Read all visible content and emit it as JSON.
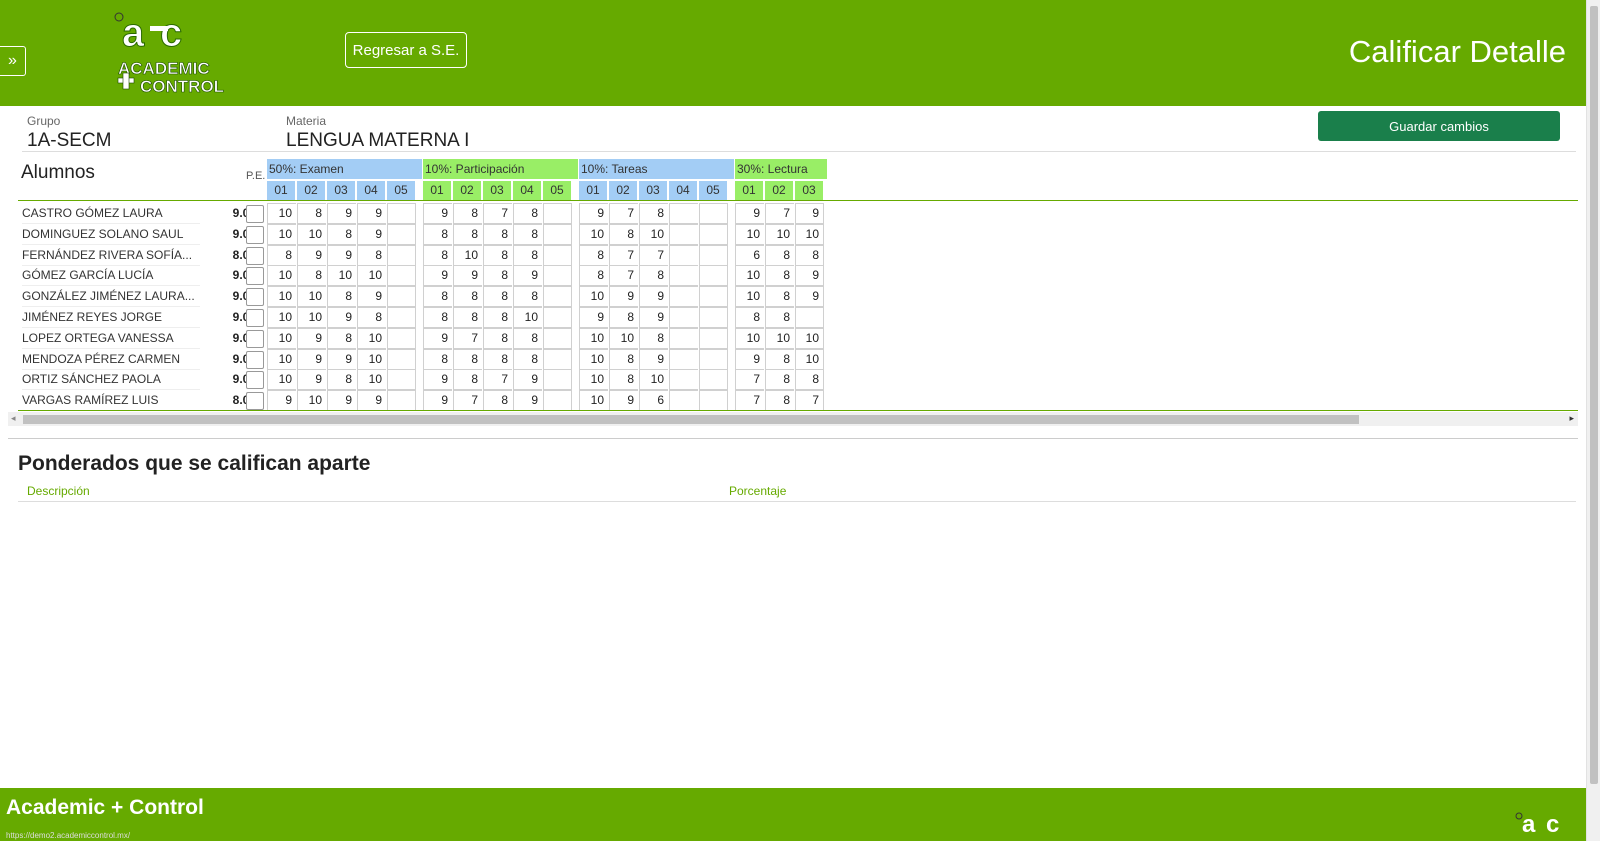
{
  "header": {
    "back_label": "Regresar a S.E.",
    "page_title": "Calificar Detalle",
    "logo_top": "ACADEMIC",
    "logo_bottom": "CONTROL",
    "colors": {
      "header": "#66aa00",
      "save_button": "#1a7f4b"
    }
  },
  "info": {
    "group_label": "Grupo",
    "group_value": "1A-SECM",
    "subject_label": "Materia",
    "subject_value": "LENGUA MATERNA I",
    "save_label": "Guardar cambios"
  },
  "grid": {
    "title": "Alumnos",
    "pe_label": "P.E.",
    "groups": [
      {
        "label": "50%: Examen",
        "cols": [
          "01",
          "02",
          "03",
          "04",
          "05"
        ],
        "color": "blue"
      },
      {
        "label": "10%: Participación",
        "cols": [
          "01",
          "02",
          "03",
          "04",
          "05"
        ],
        "color": "green"
      },
      {
        "label": "10%: Tareas",
        "cols": [
          "01",
          "02",
          "03",
          "04",
          "05"
        ],
        "color": "blue"
      },
      {
        "label": "30%: Lectura",
        "cols": [
          "01",
          "02",
          "03"
        ],
        "color": "green"
      }
    ],
    "students": [
      {
        "name": "CASTRO GÓMEZ LAURA",
        "avg": "9.00",
        "scores": [
          "10",
          "8",
          "9",
          "9",
          "",
          "9",
          "8",
          "7",
          "8",
          "",
          "9",
          "7",
          "8",
          "",
          "",
          "9",
          "7",
          "9"
        ]
      },
      {
        "name": "DOMINGUEZ SOLANO SAUL",
        "avg": "9.00",
        "scores": [
          "10",
          "10",
          "8",
          "9",
          "",
          "8",
          "8",
          "8",
          "8",
          "",
          "10",
          "8",
          "10",
          "",
          "",
          "10",
          "10",
          "10"
        ]
      },
      {
        "name": "FERNÁNDEZ RIVERA SOFÍA...",
        "avg": "8.00",
        "scores": [
          "8",
          "9",
          "9",
          "8",
          "",
          "8",
          "10",
          "8",
          "8",
          "",
          "8",
          "7",
          "7",
          "",
          "",
          "6",
          "8",
          "8"
        ]
      },
      {
        "name": "GÓMEZ GARCÍA LUCÍA",
        "avg": "9.00",
        "scores": [
          "10",
          "8",
          "10",
          "10",
          "",
          "9",
          "9",
          "8",
          "9",
          "",
          "8",
          "7",
          "8",
          "",
          "",
          "10",
          "8",
          "9"
        ]
      },
      {
        "name": "GONZÁLEZ JIMÉNEZ LAURA...",
        "avg": "9.00",
        "scores": [
          "10",
          "10",
          "8",
          "9",
          "",
          "8",
          "8",
          "8",
          "8",
          "",
          "10",
          "9",
          "9",
          "",
          "",
          "10",
          "8",
          "9"
        ]
      },
      {
        "name": "JIMÉNEZ REYES JORGE",
        "avg": "9.00",
        "scores": [
          "10",
          "10",
          "9",
          "8",
          "",
          "8",
          "8",
          "8",
          "10",
          "",
          "9",
          "8",
          "9",
          "",
          "",
          "8",
          "8",
          ""
        ]
      },
      {
        "name": "LOPEZ ORTEGA VANESSA",
        "avg": "9.00",
        "scores": [
          "10",
          "9",
          "8",
          "10",
          "",
          "9",
          "7",
          "8",
          "8",
          "",
          "10",
          "10",
          "8",
          "",
          "",
          "10",
          "10",
          "10"
        ]
      },
      {
        "name": "MENDOZA PÉREZ CARMEN",
        "avg": "9.00",
        "scores": [
          "10",
          "9",
          "9",
          "10",
          "",
          "8",
          "8",
          "8",
          "8",
          "",
          "10",
          "8",
          "9",
          "",
          "",
          "9",
          "8",
          "10"
        ]
      },
      {
        "name": "ORTIZ SÁNCHEZ PAOLA",
        "avg": "9.00",
        "scores": [
          "10",
          "9",
          "8",
          "10",
          "",
          "9",
          "8",
          "7",
          "9",
          "",
          "10",
          "8",
          "10",
          "",
          "",
          "7",
          "8",
          "8"
        ]
      },
      {
        "name": "VARGAS RAMÍREZ LUIS",
        "avg": "8.00",
        "scores": [
          "9",
          "10",
          "9",
          "9",
          "",
          "9",
          "7",
          "8",
          "9",
          "",
          "10",
          "9",
          "6",
          "",
          "",
          "7",
          "8",
          "7"
        ]
      }
    ]
  },
  "weighted": {
    "title": "Ponderados que se califican aparte",
    "col_description": "Descripción",
    "col_percentage": "Porcentaje"
  },
  "footer": {
    "brand": "Academic + Control",
    "status_url": "https://demo2.academiccontrol.mx/"
  }
}
